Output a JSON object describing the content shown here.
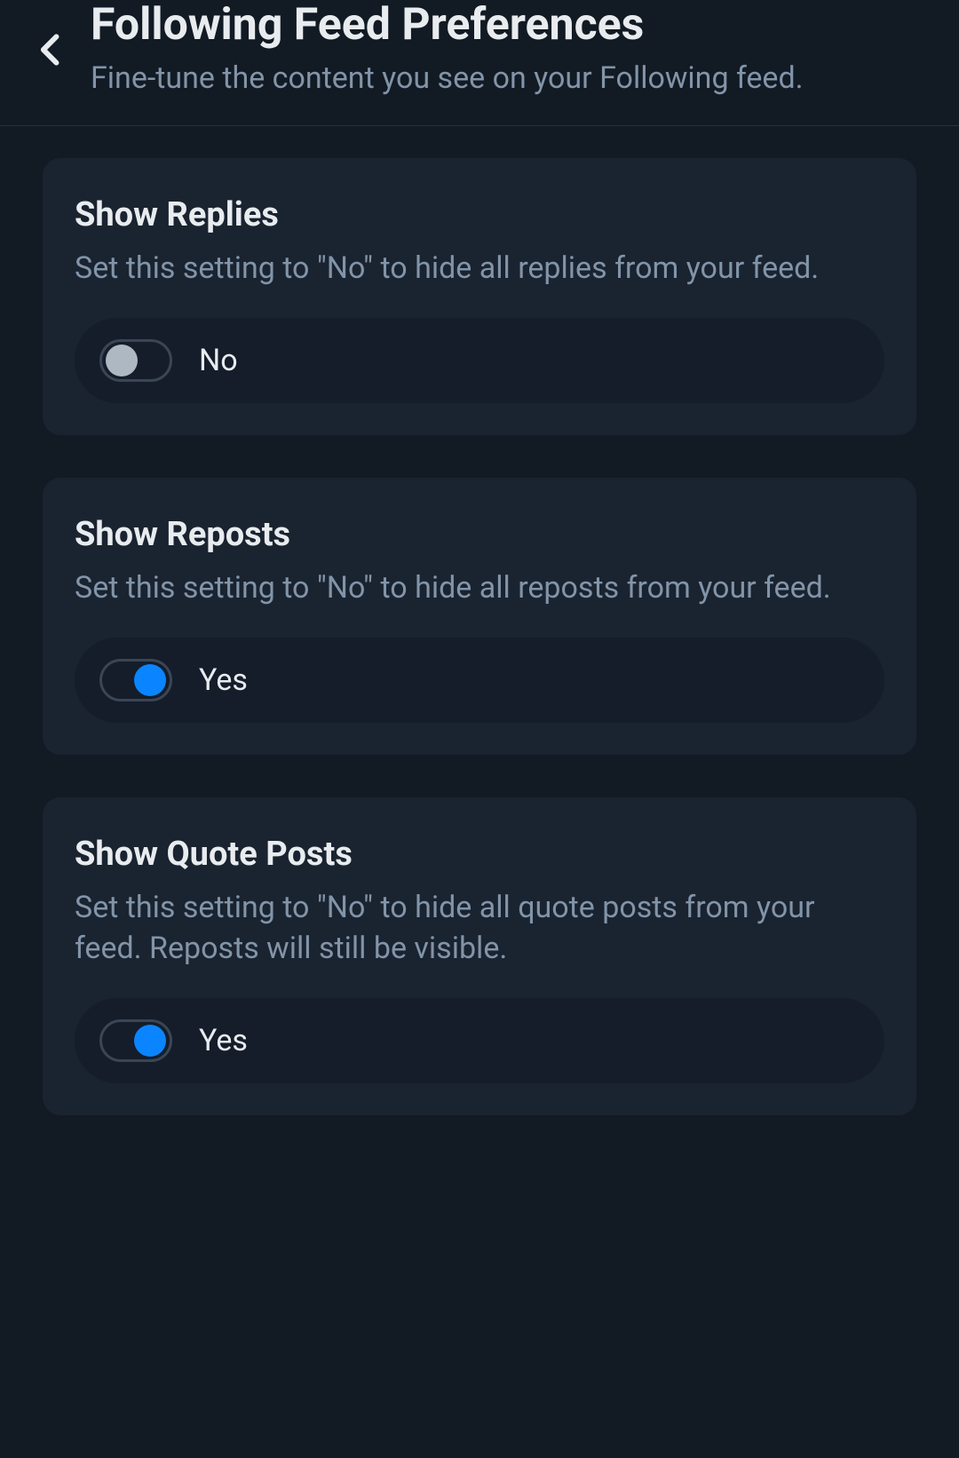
{
  "header": {
    "title": "Following Feed Preferences",
    "subtitle": "Fine-tune the content you see on your Following feed."
  },
  "labels": {
    "yes": "Yes",
    "no": "No"
  },
  "settings": [
    {
      "id": "show-replies",
      "title": "Show Replies",
      "description": "Set this setting to \"No\" to hide all replies from your feed.",
      "value": false
    },
    {
      "id": "show-reposts",
      "title": "Show Reposts",
      "description": "Set this setting to \"No\" to hide all reposts from your feed.",
      "value": true
    },
    {
      "id": "show-quote-posts",
      "title": "Show Quote Posts",
      "description": "Set this setting to \"No\" to hide all quote posts from your feed. Reposts will still be visible.",
      "value": true
    }
  ],
  "colors": {
    "accent": "#0a85ff",
    "background": "#121a24",
    "card": "#1a2330",
    "muted": "#8294a8"
  }
}
